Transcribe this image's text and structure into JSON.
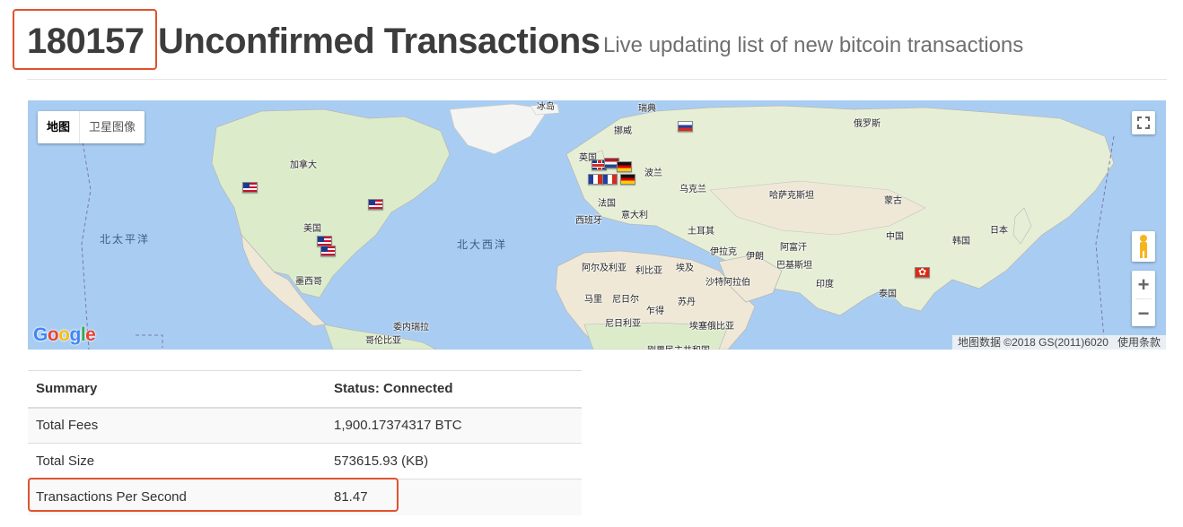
{
  "header": {
    "count": "180157",
    "title": "Unconfirmed Transactions",
    "subtitle": "Live updating list of new bitcoin transactions"
  },
  "map": {
    "map_type_buttons": [
      "地图",
      "卫星图像"
    ],
    "oceans": [
      "北太平洋",
      "北大西洋"
    ],
    "country_labels": {
      "greenland": "冰岛",
      "sweden": "瑞典",
      "norway": "挪威",
      "russia": "俄罗斯",
      "canada": "加拿大",
      "uk": "英国",
      "poland": "波兰",
      "ukraine": "乌克兰",
      "france": "法国",
      "kazakhstan": "哈萨克斯坦",
      "mongolia": "蒙古",
      "spain": "西班牙",
      "italy": "意大利",
      "usa": "美国",
      "turkey": "土耳其",
      "china": "中国",
      "korea": "韩国",
      "japan": "日本",
      "iraq": "伊拉克",
      "iran": "伊朗",
      "afghanistan": "阿富汗",
      "pakistan": "巴基斯坦",
      "algeria": "阿尔及利亚",
      "libya": "利比亚",
      "egypt": "埃及",
      "mexico": "墨西哥",
      "saudi": "沙特阿拉伯",
      "india": "印度",
      "thailand": "泰国",
      "mali": "马里",
      "niger": "尼日尔",
      "sudan": "苏丹",
      "chad": "乍得",
      "nigeria": "尼日利亚",
      "ethiopia": "埃塞俄比亚",
      "venezuela": "委内瑞拉",
      "colombia": "哥伦比亚",
      "drc": "刚果民主共和国"
    },
    "flags": [
      "us",
      "us",
      "us",
      "us",
      "ru",
      "gb",
      "nl",
      "de",
      "fr",
      "fr",
      "de",
      "hk"
    ],
    "attribution": "地图数据 ©2018 GS(2011)6020",
    "terms": "使用条款",
    "google_logo": "Google",
    "colors": {
      "water": "#a9cdf2",
      "land": "#f2efe9",
      "forest": "#cde6b8",
      "desert": "#efe8d6"
    }
  },
  "summary": {
    "headers": [
      "Summary",
      "Status: Connected"
    ],
    "rows": [
      [
        "Total Fees",
        "1,900.17374317 BTC"
      ],
      [
        "Total Size",
        "573615.93 (KB)"
      ],
      [
        "Transactions Per Second",
        "81.47"
      ]
    ]
  },
  "highlight_color": "#e0522e"
}
